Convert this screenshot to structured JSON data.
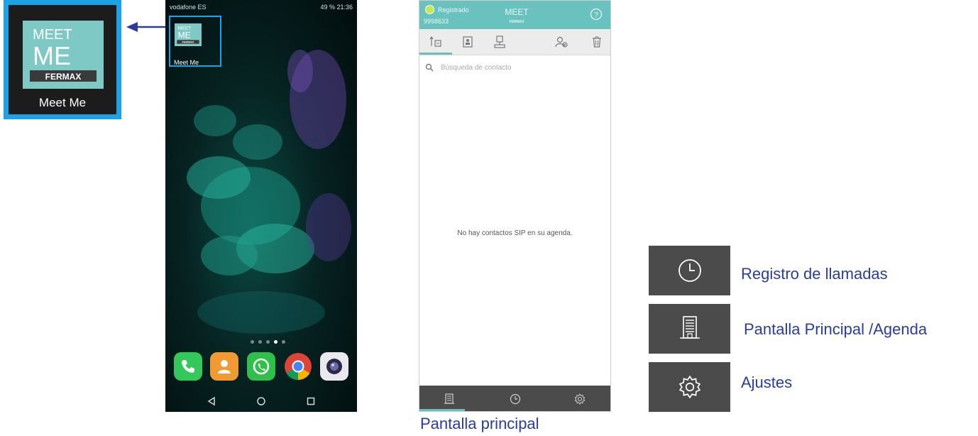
{
  "zoom": {
    "label": "Meet Me"
  },
  "logo": {
    "meet": "MEET",
    "me": "ME",
    "brand": "FERMAX"
  },
  "phone": {
    "status_left": "vodafone ES",
    "status_right": "49 % 21:36",
    "home_icon_label": "Meet Me",
    "dock": [
      "phone-icon",
      "contacts-icon",
      "whatsapp-icon",
      "chrome-icon",
      "camera-icon"
    ]
  },
  "app": {
    "status": "Registrado",
    "number": "9998633",
    "brand_logo": "MEET",
    "brand_sub": "FERMAX",
    "search_placeholder": "Búsqueda de contacto",
    "empty_message": "No hay contactos SIP en su agenda."
  },
  "caption": "Pantalla principal",
  "legend": [
    {
      "icon": "clock-icon",
      "label": "Registro de llamadas"
    },
    {
      "icon": "building-icon",
      "label": "Pantalla Principal /Agenda"
    },
    {
      "icon": "gear-icon",
      "label": "Ajustes"
    }
  ],
  "colors": {
    "highlight": "#1aa3e8",
    "teal": "#6ac2bf",
    "legend_text": "#2b3c9a",
    "dark_bar": "#4b4b4b"
  }
}
